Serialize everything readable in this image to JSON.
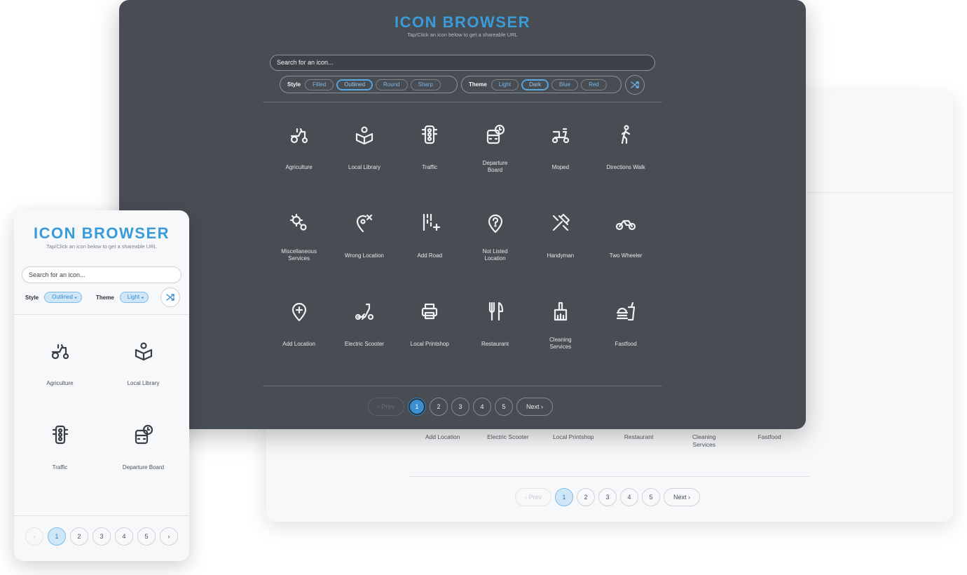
{
  "app": {
    "title": "ICON BROWSER",
    "subtitle": "Tap/Click an icon below to get a shareable URL",
    "accent_color": "#3a9bd9"
  },
  "search": {
    "placeholder": "Search for an icon..."
  },
  "filters": {
    "style_label": "Style",
    "style_options": [
      "Filled",
      "Outlined",
      "Round",
      "Sharp"
    ],
    "style_selected": "Outlined",
    "theme_label": "Theme",
    "theme_options": [
      "Light",
      "Dark",
      "Blue",
      "Red"
    ],
    "theme_selected_dark": "Dark",
    "theme_selected_mobile": "Light",
    "shuffle_icon": "shuffle-icon"
  },
  "icons": [
    {
      "label": "Agriculture",
      "icon": "tractor-icon"
    },
    {
      "label": "Local Library",
      "icon": "library-icon"
    },
    {
      "label": "Traffic",
      "icon": "traffic-light-icon"
    },
    {
      "label": "Departure\nBoard",
      "icon": "departure-board-icon"
    },
    {
      "label": "Moped",
      "icon": "moped-icon"
    },
    {
      "label": "Directions Walk",
      "icon": "walk-icon"
    },
    {
      "label": "Miscellaneous\nServices",
      "icon": "gears-icon"
    },
    {
      "label": "Wrong Location",
      "icon": "wrong-location-icon"
    },
    {
      "label": "Add Road",
      "icon": "add-road-icon"
    },
    {
      "label": "Not Listed\nLocation",
      "icon": "not-listed-location-icon"
    },
    {
      "label": "Handyman",
      "icon": "handyman-icon"
    },
    {
      "label": "Two Wheeler",
      "icon": "motorcycle-icon"
    },
    {
      "label": "Add Location",
      "icon": "add-location-icon"
    },
    {
      "label": "Electric Scooter",
      "icon": "electric-scooter-icon"
    },
    {
      "label": "Local Printshop",
      "icon": "printer-icon"
    },
    {
      "label": "Restaurant",
      "icon": "restaurant-icon"
    },
    {
      "label": "Cleaning\nServices",
      "icon": "cleaning-icon"
    },
    {
      "label": "Fastfood",
      "icon": "fastfood-icon"
    }
  ],
  "mobile_icons": [
    {
      "label": "Agriculture",
      "icon": "tractor-icon"
    },
    {
      "label": "Local Library",
      "icon": "library-icon"
    },
    {
      "label": "Traffic",
      "icon": "traffic-light-icon"
    },
    {
      "label": "Departure Board",
      "icon": "departure-board-icon"
    }
  ],
  "pagination": {
    "prev": "‹ Prev",
    "next": "Next ›",
    "pages": [
      "1",
      "2",
      "3",
      "4",
      "5"
    ],
    "current": "1",
    "prev_arrow": "‹",
    "next_arrow": "›"
  }
}
